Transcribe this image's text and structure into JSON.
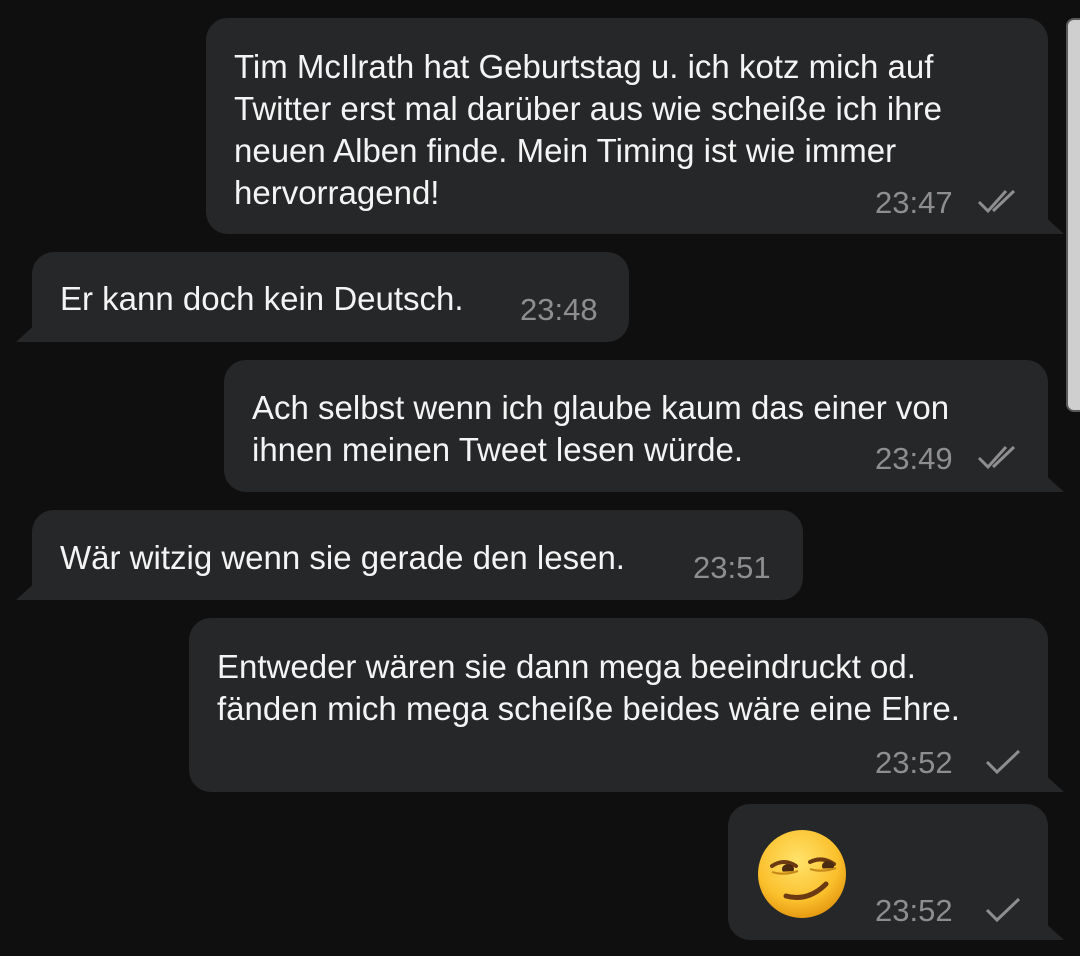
{
  "messages": [
    {
      "direction": "outgoing",
      "lines": [
        "Tim McIlrath hat Geburtstag u. ich kotz mich auf",
        "Twitter erst mal darüber aus wie scheiße ich ihre",
        "neuen Alben finde. Mein Timing ist wie immer",
        "hervorragend!"
      ],
      "time": "23:47",
      "status": "read-double-check"
    },
    {
      "direction": "incoming",
      "lines": [
        "Er kann doch kein Deutsch."
      ],
      "time": "23:48"
    },
    {
      "direction": "outgoing",
      "lines": [
        "Ach selbst wenn ich glaube kaum das einer von",
        "ihnen meinen Tweet lesen würde."
      ],
      "time": "23:49",
      "status": "read-double-check"
    },
    {
      "direction": "incoming",
      "lines": [
        "Wär witzig wenn sie gerade den lesen."
      ],
      "time": "23:51"
    },
    {
      "direction": "outgoing",
      "lines": [
        "Entweder wären sie dann mega beeindruckt od.",
        "fänden mich mega scheiße beides wäre eine Ehre."
      ],
      "time": "23:52",
      "status": "sent-single-check"
    },
    {
      "direction": "outgoing",
      "emoji": "smirking-face-icon",
      "time": "23:52",
      "status": "sent-single-check"
    }
  ],
  "colors": {
    "background": "#0f0f0f",
    "bubble": "#262729",
    "text": "#f4f4f4",
    "meta": "#8e8e90"
  }
}
